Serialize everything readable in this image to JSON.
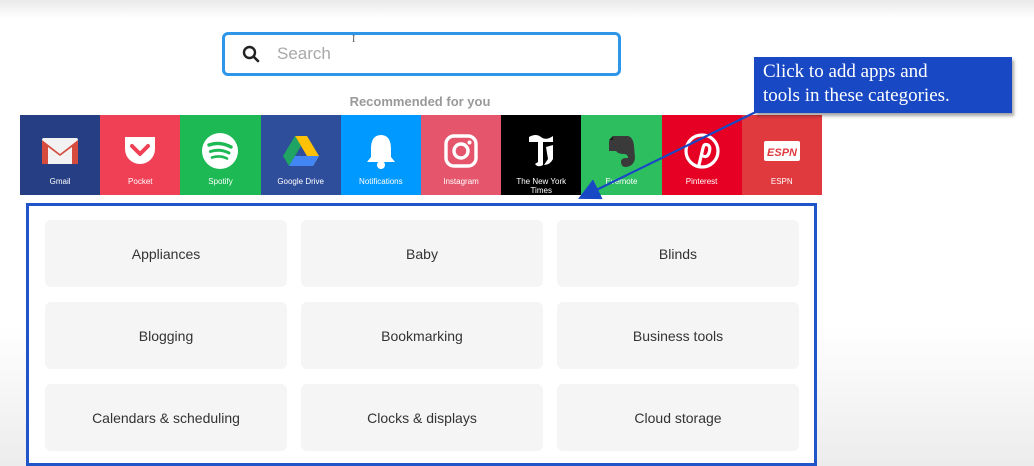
{
  "search": {
    "placeholder": "Search"
  },
  "recommended": {
    "heading": "Recommended for you",
    "apps": [
      {
        "label": "Gmail",
        "color": "#263f84",
        "icon": "gmail-icon"
      },
      {
        "label": "Pocket",
        "color": "#ef4056",
        "icon": "pocket-icon"
      },
      {
        "label": "Spotify",
        "color": "#1db954",
        "icon": "spotify-icon"
      },
      {
        "label": "Google Drive",
        "color": "#2e4d9a",
        "icon": "google-drive-icon"
      },
      {
        "label": "Notifications",
        "color": "#0099ff",
        "icon": "bell-icon"
      },
      {
        "label": "Instagram",
        "color": "#e5566c",
        "icon": "instagram-icon"
      },
      {
        "label": "The New York\nTimes",
        "color": "#000000",
        "icon": "nyt-icon"
      },
      {
        "label": "Evernote",
        "color": "#2dbe60",
        "icon": "evernote-icon"
      },
      {
        "label": "Pinterest",
        "color": "#e60023",
        "icon": "pinterest-icon"
      },
      {
        "label": "ESPN",
        "color": "#e03a3e",
        "icon": "espn-icon"
      }
    ]
  },
  "categories": [
    "Appliances",
    "Baby",
    "Blinds",
    "Blogging",
    "Bookmarking",
    "Business tools",
    "Calendars & scheduling",
    "Clocks & displays",
    "Cloud storage"
  ],
  "callout": {
    "text": "Click to add apps and\ntools in these categories.",
    "color": "#1848c4"
  },
  "cursor_glyph": "I",
  "espn_logo_text": "ESPN"
}
